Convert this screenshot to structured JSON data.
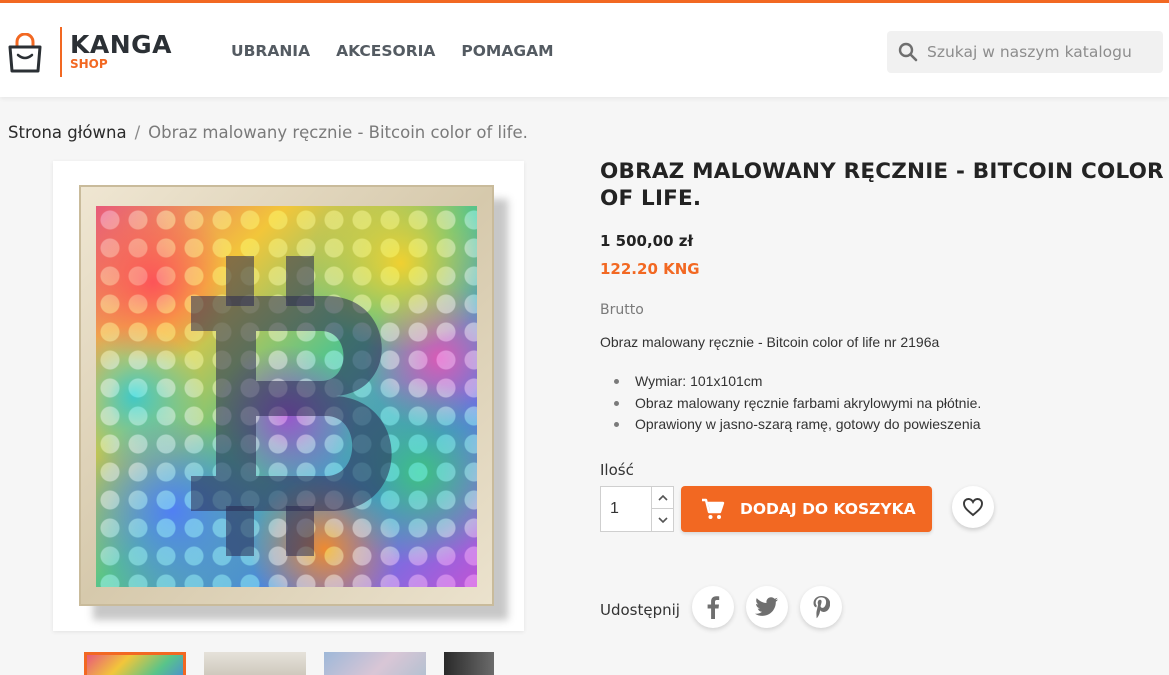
{
  "brand": {
    "name": "KANGA",
    "sub": "SHOP",
    "accent_color": "#f26822"
  },
  "nav": {
    "items": [
      "UBRANIA",
      "AKCESORIA",
      "POMAGAM"
    ]
  },
  "search": {
    "placeholder": "Szukaj w naszym katalogu",
    "icon": "search-icon"
  },
  "breadcrumb": {
    "home": "Strona główna",
    "separator": "/",
    "current": "Obraz malowany ręcznie - Bitcoin color of life."
  },
  "product": {
    "title": "OBRAZ MALOWANY RĘCZNIE - BITCOIN COLOR OF LIFE.",
    "price": "1 500,00 zł",
    "price_kng": "122.20 KNG",
    "tax_label": "Brutto",
    "short_description": "Obraz malowany ręcznie - Bitcoin color of life nr 2196a",
    "features": [
      "Wymiar: 101x101cm",
      "Obraz malowany ręcznie farbami akrylowymi na płótnie.",
      "Oprawiony w jasno-szarą ramę, gotowy do powieszenia"
    ]
  },
  "quantity": {
    "label": "Ilość",
    "value": "1"
  },
  "cart": {
    "button_label": "DODAJ DO KOSZYKA",
    "icon": "cart-icon"
  },
  "wishlist": {
    "icon": "heart-icon"
  },
  "share": {
    "label": "Udostępnij",
    "networks": [
      "facebook-icon",
      "twitter-icon",
      "pinterest-icon"
    ]
  }
}
